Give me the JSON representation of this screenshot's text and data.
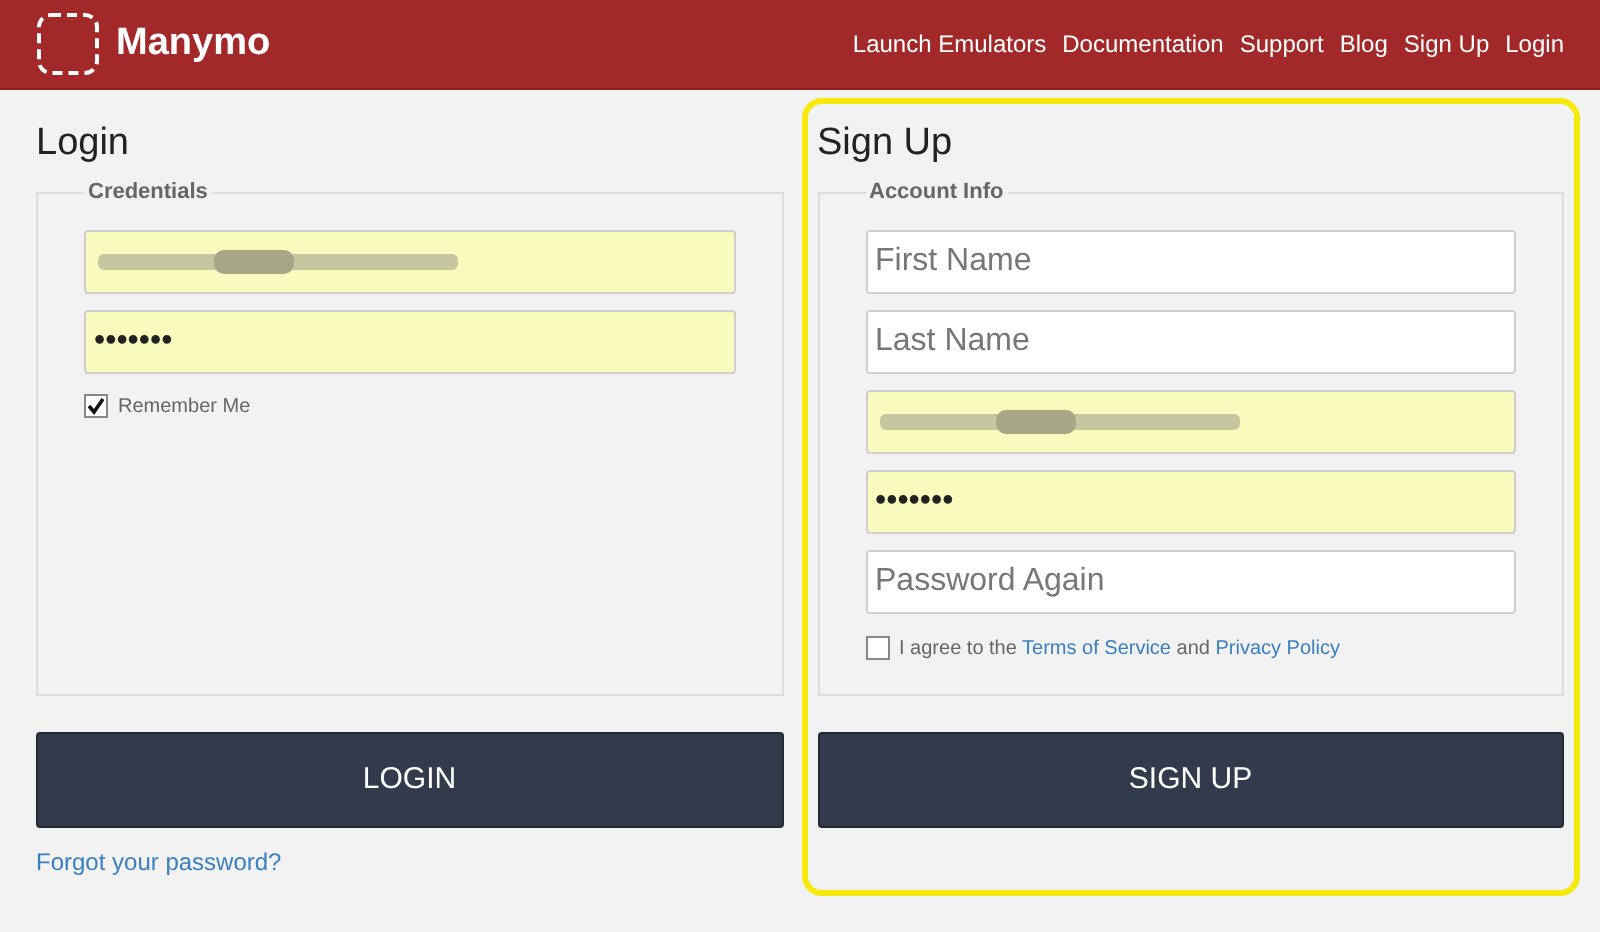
{
  "header": {
    "logo_text": "Manymo",
    "nav": [
      "Launch Emulators",
      "Documentation",
      "Support",
      "Blog",
      "Sign Up",
      "Login"
    ]
  },
  "login": {
    "title": "Login",
    "legend": "Credentials",
    "fields": [
      {
        "kind": "redacted",
        "autofilled": true
      },
      {
        "kind": "password",
        "value": "•••••••",
        "autofilled": true
      }
    ],
    "remember": {
      "label": "Remember Me",
      "checked": true
    },
    "button": "LOGIN",
    "forgot_link": "Forgot your password?"
  },
  "signup": {
    "title": "Sign Up",
    "legend": "Account Info",
    "highlighted": true,
    "fields": [
      {
        "kind": "text",
        "placeholder": "First Name",
        "autofilled": false
      },
      {
        "kind": "text",
        "placeholder": "Last Name",
        "autofilled": false
      },
      {
        "kind": "redacted",
        "autofilled": true
      },
      {
        "kind": "password",
        "value": "•••••••",
        "autofilled": true
      },
      {
        "kind": "text",
        "placeholder": "Password Again",
        "autofilled": false
      }
    ],
    "agree": {
      "checked": false,
      "parts": [
        {
          "kind": "text",
          "text": "I agree to the "
        },
        {
          "kind": "link",
          "text": "Terms of Service"
        },
        {
          "kind": "text",
          "text": " and "
        },
        {
          "kind": "link",
          "text": "Privacy Policy"
        }
      ]
    },
    "button": "SIGN UP"
  }
}
